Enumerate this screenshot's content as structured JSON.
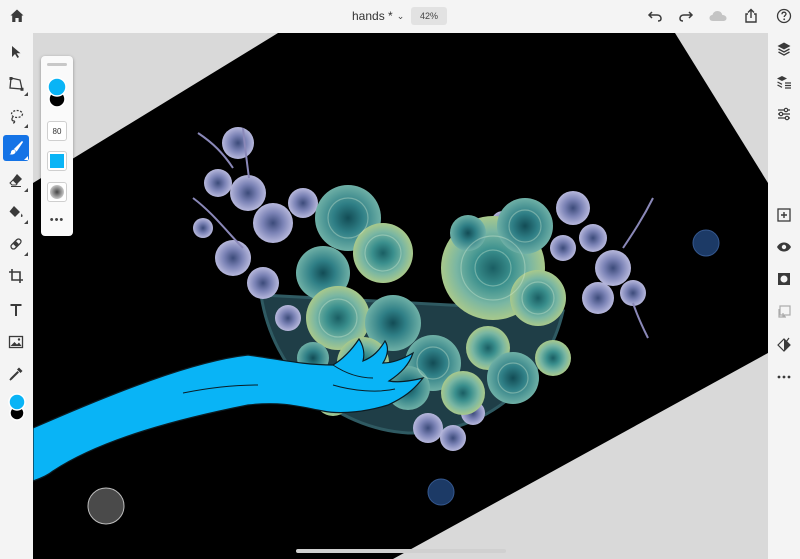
{
  "app": {
    "document_title": "hands *",
    "zoom_label": "42%"
  },
  "brush_panel": {
    "size_value": "80",
    "more_label": "•••"
  },
  "colors": {
    "accent": "#1473e6",
    "primary_color": "#09b4f6",
    "secondary_color": "#000000",
    "canvas_fill": "#000000",
    "pasteboard": "#d9d9d9"
  },
  "left_tools": [
    {
      "name": "select-tool",
      "icon": "arrow-pointer-icon"
    },
    {
      "name": "transform-tool",
      "icon": "transform-icon"
    },
    {
      "name": "lasso-tool",
      "icon": "lasso-icon"
    },
    {
      "name": "brush-tool",
      "icon": "brush-icon",
      "active": true
    },
    {
      "name": "eraser-tool",
      "icon": "eraser-icon"
    },
    {
      "name": "fill-tool",
      "icon": "paint-bucket-icon"
    },
    {
      "name": "healing-tool",
      "icon": "bandage-icon"
    },
    {
      "name": "crop-tool",
      "icon": "crop-icon"
    },
    {
      "name": "type-tool",
      "icon": "type-icon"
    },
    {
      "name": "place-image-tool",
      "icon": "image-icon"
    },
    {
      "name": "eyedropper-tool",
      "icon": "eyedropper-icon"
    }
  ],
  "right_tools": [
    {
      "name": "layers",
      "icon": "layers-icon"
    },
    {
      "name": "layer-properties",
      "icon": "layer-properties-icon"
    },
    {
      "name": "adjustments",
      "icon": "sliders-icon"
    },
    {
      "name": "add-layer",
      "icon": "add-layer-icon"
    },
    {
      "name": "visibility",
      "icon": "eye-icon"
    },
    {
      "name": "mask",
      "icon": "mask-icon"
    },
    {
      "name": "clipping",
      "icon": "clip-icon"
    },
    {
      "name": "layer-effects",
      "icon": "effects-icon"
    },
    {
      "name": "more",
      "icon": "more-icon"
    }
  ],
  "top_actions": [
    {
      "name": "undo",
      "icon": "undo-icon"
    },
    {
      "name": "redo",
      "icon": "redo-icon"
    },
    {
      "name": "cloud",
      "icon": "cloud-icon"
    },
    {
      "name": "share",
      "icon": "share-icon"
    },
    {
      "name": "help",
      "icon": "help-icon"
    }
  ]
}
